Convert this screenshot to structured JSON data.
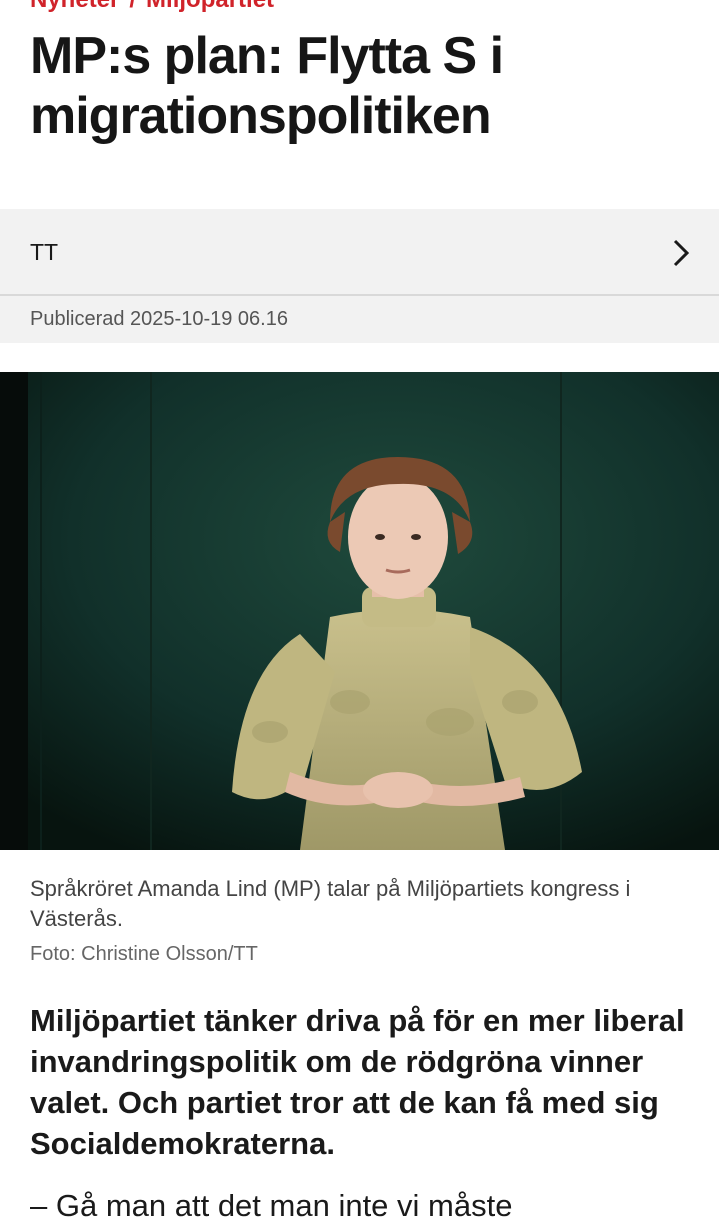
{
  "breadcrumb": {
    "section": "Nyheter",
    "separator": "/",
    "topic": "Miljöpartiet"
  },
  "article": {
    "title": "MP:s plan: Flytta S i migrationspolitiken",
    "author": "TT",
    "published": "Publicerad 2025-10-19 06.16",
    "image_caption": "Språkröret Amanda Lind (MP) talar på Miljöpartiets kongress i Västerås.",
    "image_credit": "Foto: Christine Olsson/TT",
    "lead": "Miljöpartiet tänker driva på för en mer liberal invandringspolitik om de rödgröna vinner valet. Och partiet tror att de kan få med sig Socialdemokraterna.",
    "next_text": "– Gå man att det man inte vi måste"
  },
  "icons": {
    "author_chevron": "chevron-right-icon"
  },
  "colors": {
    "accent": "#d0232a",
    "bar_bg": "#f2f2f2",
    "photo_bg": "#0f2a22"
  }
}
